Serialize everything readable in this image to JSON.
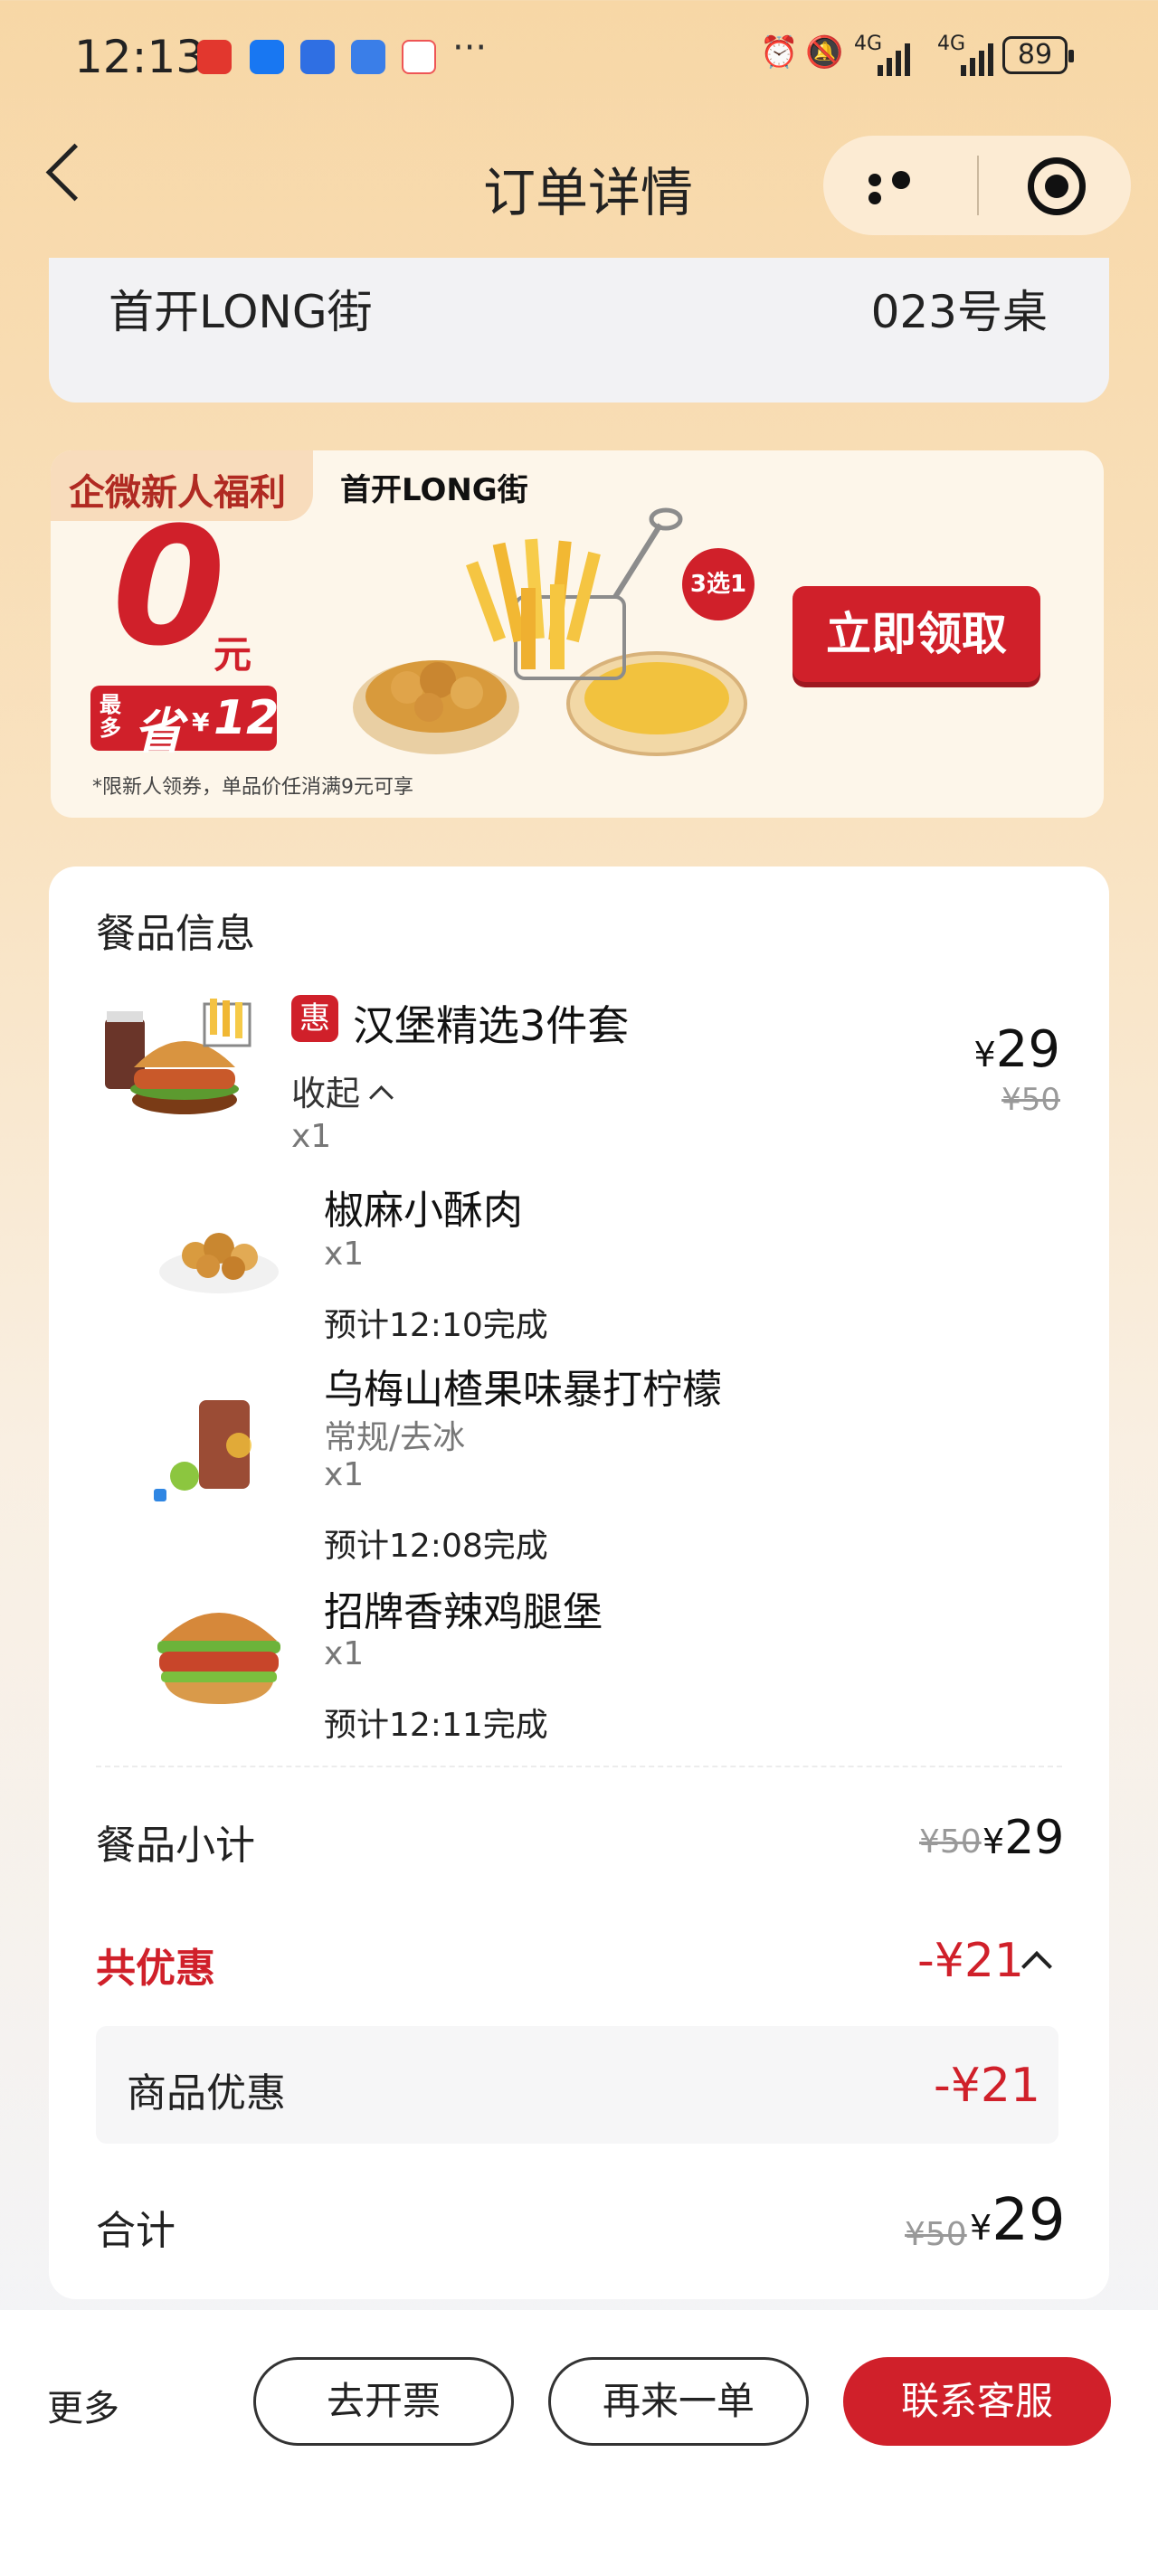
{
  "status_bar": {
    "time": "12:13",
    "more_dots": "···",
    "network_1": "4G",
    "network_2": "4G",
    "battery": "89"
  },
  "nav": {
    "title": "订单详情",
    "icons": [
      "back-arrow-icon",
      "more-dots-icon",
      "target-icon"
    ]
  },
  "store": {
    "name": "首开LONG街",
    "table": "023号桌"
  },
  "promo": {
    "tag": "企微新人福利",
    "store": "首开LONG街",
    "amount": "0",
    "unit": "元",
    "save_prefix": "最多",
    "save_word": "省",
    "save_currency": "¥",
    "save_amount": "12",
    "badge": "3选1",
    "cta": "立即领取",
    "note": "*限新人领券，单品价任消满9元可享"
  },
  "order": {
    "section_title": "餐品信息",
    "combo": {
      "badge": "惠",
      "name": "汉堡精选3件套",
      "currency": "¥",
      "price": "29",
      "original_price": "¥50",
      "collapse_label": "收起",
      "qty": "x1"
    },
    "items": [
      {
        "name": "椒麻小酥肉",
        "spec": "",
        "qty": "x1",
        "eta": "预计12:10完成"
      },
      {
        "name": "乌梅山楂果味暴打柠檬",
        "spec": "常规/去冰",
        "qty": "x1",
        "eta": "预计12:08完成"
      },
      {
        "name": "招牌香辣鸡腿堡",
        "spec": "",
        "qty": "x1",
        "eta": "预计12:11完成"
      }
    ],
    "subtotal": {
      "label": "餐品小计",
      "original": "¥50",
      "currency": "¥",
      "value": "29"
    },
    "discount": {
      "label": "共优惠",
      "value": "-¥21"
    },
    "discount_detail": {
      "label": "商品优惠",
      "value": "-¥21"
    },
    "total": {
      "label": "合计",
      "original": "¥50",
      "currency": "¥",
      "value": "29"
    }
  },
  "bottom": {
    "more": "更多",
    "invoice": "去开票",
    "reorder": "再来一单",
    "service": "联系客服"
  },
  "colors": {
    "accent_red": "#d0202a",
    "bg_top": "#f7d7a6",
    "card": "#ffffff"
  }
}
